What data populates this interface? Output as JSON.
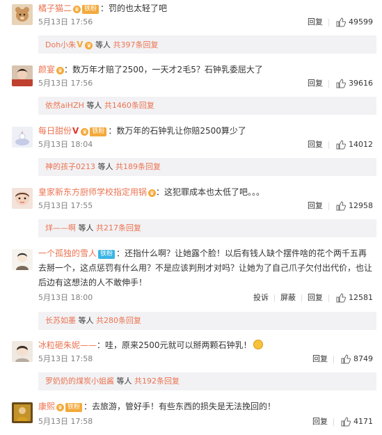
{
  "comments": [
    {
      "user": "橘子猫二",
      "badge": "铁粉",
      "text": "：罚的也太轻了吧",
      "date": "5月13日 17:56",
      "reply_label": "回复",
      "likes": "49599",
      "reply_box": {
        "name": "Doh小朱",
        "suffix": "等人",
        "more": "共397条回复"
      }
    },
    {
      "user": "颜宴",
      "text": "：数万年才赔了2500，一天才2毛5？石钟乳委屈大了",
      "date": "5月13日 17:56",
      "reply_label": "回复",
      "likes": "39616",
      "reply_box": {
        "name": "依然aiHZH",
        "suffix": "等人",
        "more": "共1460条回复"
      }
    },
    {
      "user": "每日甜份",
      "badge": "铁粉",
      "text": "：数万年的石钟乳让你赔2500算少了",
      "date": "5月13日 18:04",
      "reply_label": "回复",
      "likes": "14012",
      "reply_box": {
        "name": "神的孩子0213",
        "suffix": "等人",
        "more": "共189条回复"
      }
    },
    {
      "user": "皇家新东方厨师学校指定用锅",
      "text": "：这犯罪成本也太低了吧。。。",
      "date": "5月13日 17:55",
      "reply_label": "回复",
      "likes": "12958",
      "reply_box": {
        "name": "烊——啊",
        "suffix": "等人",
        "more": "共217条回复"
      }
    },
    {
      "user": "一个孤独的雪人",
      "badge": "铁粉",
      "text": "：还指什么啊？让她露个脸！以后有钱人缺个摆件啥的花个两千五再去掰一个，这点惩罚有什么用？不是应该判刑才对吗？让她为了自己爪子欠付出代价，也让后边有这想法的人不敢伸手！",
      "date": "5月13日 18:00",
      "report_label": "投诉",
      "block_label": "屏蔽",
      "reply_label": "回复",
      "likes": "12581",
      "reply_box": {
        "name": "长苏如墨",
        "suffix": "等人",
        "more": "共280条回复"
      }
    },
    {
      "user": "冰粒砸朱妮——",
      "text": "：哇，原来2500元就可以掰两颗石钟乳！",
      "date": "5月13日 17:58",
      "reply_label": "回复",
      "likes": "8749",
      "reply_box": {
        "name": "罗奶奶的煤炭小姐酱",
        "suffix": "等人",
        "more": "共192条回复"
      }
    },
    {
      "user": "康熙",
      "badge": "铁粉",
      "text": "：去旅游，管好手！有些东西的损失是无法挽回的！",
      "date": "5月13日 17:58",
      "reply_label": "回复",
      "likes": "4171"
    }
  ],
  "colors": {
    "username": "#eb7350",
    "reply_bg": "#f2f2f5",
    "fan_badge": "#f3a93a",
    "iron_badge": "#3bb4e5"
  },
  "icons": [
    "avatar",
    "thumbs-up-icon",
    "crown-icon",
    "verified-v-icon",
    "emoji-icon"
  ]
}
